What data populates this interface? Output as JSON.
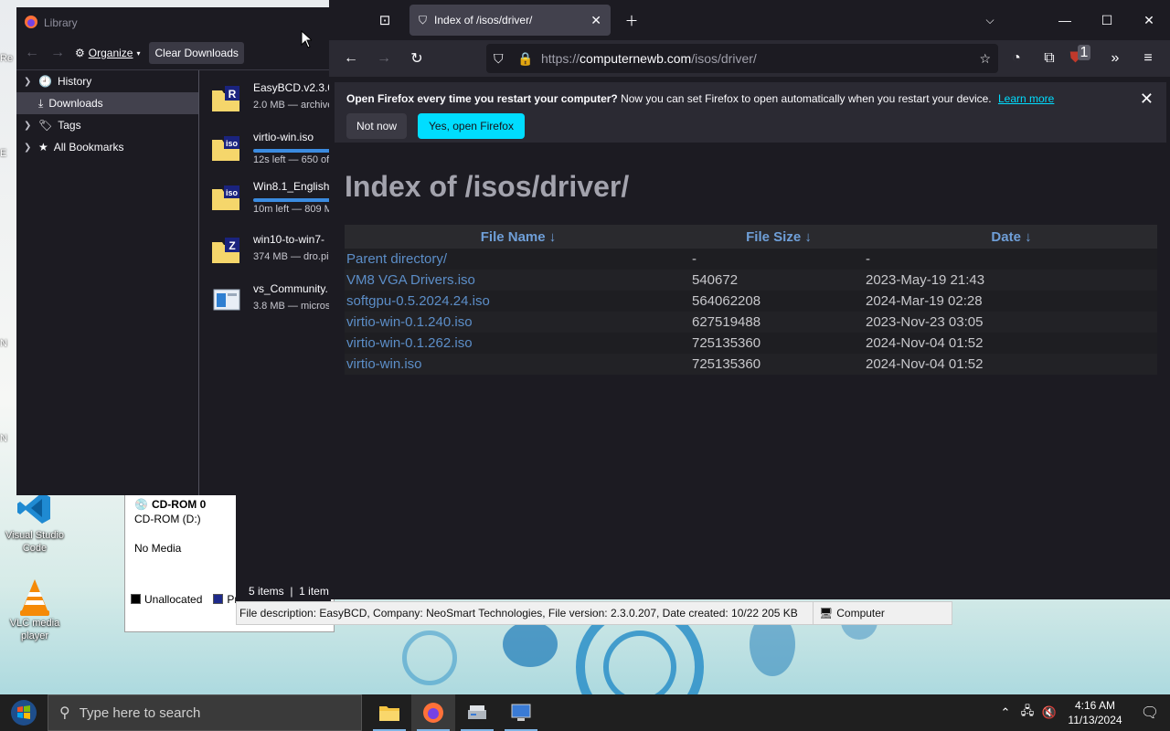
{
  "desktop": {
    "icons": [
      {
        "label": "Visual Studio Code"
      },
      {
        "label": "VLC media player"
      }
    ],
    "edge_fragments": [
      "Re",
      "E",
      "N",
      "N"
    ]
  },
  "explorer": {
    "cd_title": "CD-ROM 0",
    "cd_sub": "CD-ROM (D:)",
    "cd_media": "No Media",
    "legend_unallocated": "Unallocated",
    "legend_primary": "Pri",
    "items_count": "5 items",
    "selected_frag": "1 item",
    "status_desc": "File description: EasyBCD, Company: NeoSmart Technologies, File version: 2.3.0.207, Date created: 10/22",
    "status_size": "205 KB",
    "status_location": "Computer"
  },
  "library": {
    "title": "Library",
    "organize": "Organize",
    "clear_downloads": "Clear Downloads",
    "tree": [
      {
        "label": "History"
      },
      {
        "label": "Downloads"
      },
      {
        "label": "Tags"
      },
      {
        "label": "All Bookmarks"
      }
    ],
    "downloads": [
      {
        "name": "EasyBCD.v2.3.0.",
        "sub": "2.0 MB — archive",
        "icon": "R"
      },
      {
        "name": "virtio-win.iso",
        "sub": "12s left — 650 of",
        "icon": "iso",
        "progress": 0.95
      },
      {
        "name": "Win8.1_English_",
        "sub": "10m left — 809 M",
        "icon": "iso",
        "progress": 0.4
      },
      {
        "name": "win10-to-win7-",
        "sub": "374 MB — dro.pi",
        "icon": "Z"
      },
      {
        "name": "vs_Community.",
        "sub": "3.8 MB — micros",
        "icon": "vs"
      }
    ]
  },
  "firefox": {
    "tab_title": "Index of /isos/driver/",
    "url_scheme": "https://",
    "url_host": "computernewb.com",
    "url_path": "/isos/driver/",
    "extension_badge": "1",
    "notification": {
      "bold": "Open Firefox every time you restart your computer?",
      "text": "Now you can set Firefox to open automatically when you restart your device.",
      "link": "Learn more",
      "not_now": "Not now",
      "yes": "Yes, open Firefox"
    },
    "page": {
      "heading": "Index of /isos/driver/",
      "columns": {
        "name": "File Name  ↓",
        "size": "File Size  ↓",
        "date": "Date  ↓"
      },
      "rows": [
        {
          "name": "Parent directory/",
          "size": "-",
          "date": "-"
        },
        {
          "name": "VM8 VGA Drivers.iso",
          "size": "540672",
          "date": "2023-May-19 21:43"
        },
        {
          "name": "softgpu-0.5.2024.24.iso",
          "size": "564062208",
          "date": "2024-Mar-19 02:28"
        },
        {
          "name": "virtio-win-0.1.240.iso",
          "size": "627519488",
          "date": "2023-Nov-23 03:05"
        },
        {
          "name": "virtio-win-0.1.262.iso",
          "size": "725135360",
          "date": "2024-Nov-04 01:52"
        },
        {
          "name": "virtio-win.iso",
          "size": "725135360",
          "date": "2024-Nov-04 01:52"
        }
      ]
    }
  },
  "taskbar": {
    "search_placeholder": "Type here to search",
    "time": "4:16 AM",
    "date": "11/13/2024"
  }
}
